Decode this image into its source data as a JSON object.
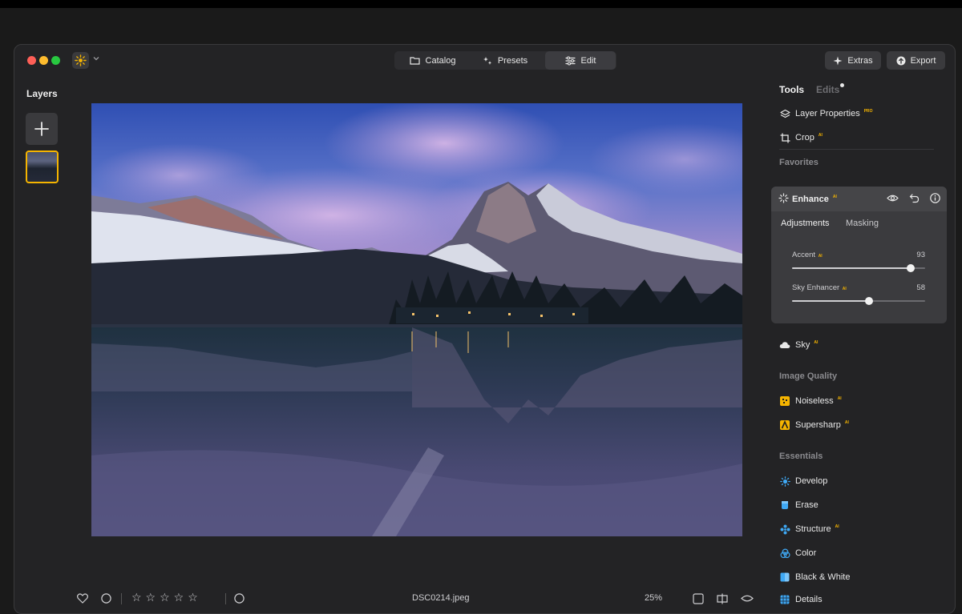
{
  "app": {
    "logo_icon": "sun-icon",
    "modes": [
      {
        "label": "Catalog",
        "icon": "folder-icon",
        "active": false
      },
      {
        "label": "Presets",
        "icon": "sparkle-icon",
        "active": false
      },
      {
        "label": "Edit",
        "icon": "sliders-icon",
        "active": true
      }
    ],
    "extras_label": "Extras",
    "export_label": "Export"
  },
  "layers": {
    "title": "Layers",
    "add_icon": "plus-icon"
  },
  "tools_panel": {
    "tabs": {
      "tools": "Tools",
      "edits": "Edits"
    },
    "top_tools": [
      {
        "label": "Layer Properties",
        "badge": "PRO",
        "icon": "layers-icon"
      },
      {
        "label": "Crop",
        "badge": "AI",
        "icon": "crop-icon"
      }
    ],
    "favorites_label": "Favorites",
    "enhance": {
      "label": "Enhance",
      "badge": "AI",
      "subtabs": [
        "Adjustments",
        "Masking"
      ],
      "active_subtab": "Adjustments",
      "sliders": [
        {
          "label": "Accent",
          "badge": "AI",
          "value": "93",
          "position": 0.89
        },
        {
          "label": "Sky Enhancer",
          "badge": "AI",
          "value": "58",
          "position": 0.58
        }
      ]
    },
    "sky": {
      "label": "Sky",
      "badge": "AI"
    },
    "image_quality_label": "Image Quality",
    "image_quality_tools": [
      {
        "label": "Noiseless",
        "badge": "AI"
      },
      {
        "label": "Supersharp",
        "badge": "AI"
      }
    ],
    "essentials_label": "Essentials",
    "essentials": [
      {
        "label": "Develop",
        "badge": ""
      },
      {
        "label": "Erase",
        "badge": ""
      },
      {
        "label": "Structure",
        "badge": "AI"
      },
      {
        "label": "Color",
        "badge": ""
      },
      {
        "label": "Black & White",
        "badge": ""
      },
      {
        "label": "Details",
        "badge": ""
      }
    ]
  },
  "bottom_bar": {
    "filename": "DSC0214.jpeg",
    "zoom": "25%"
  },
  "colors": {
    "accent": "#f5b400",
    "blue_icon": "#3fa9f5",
    "window_bg": "#232325"
  }
}
